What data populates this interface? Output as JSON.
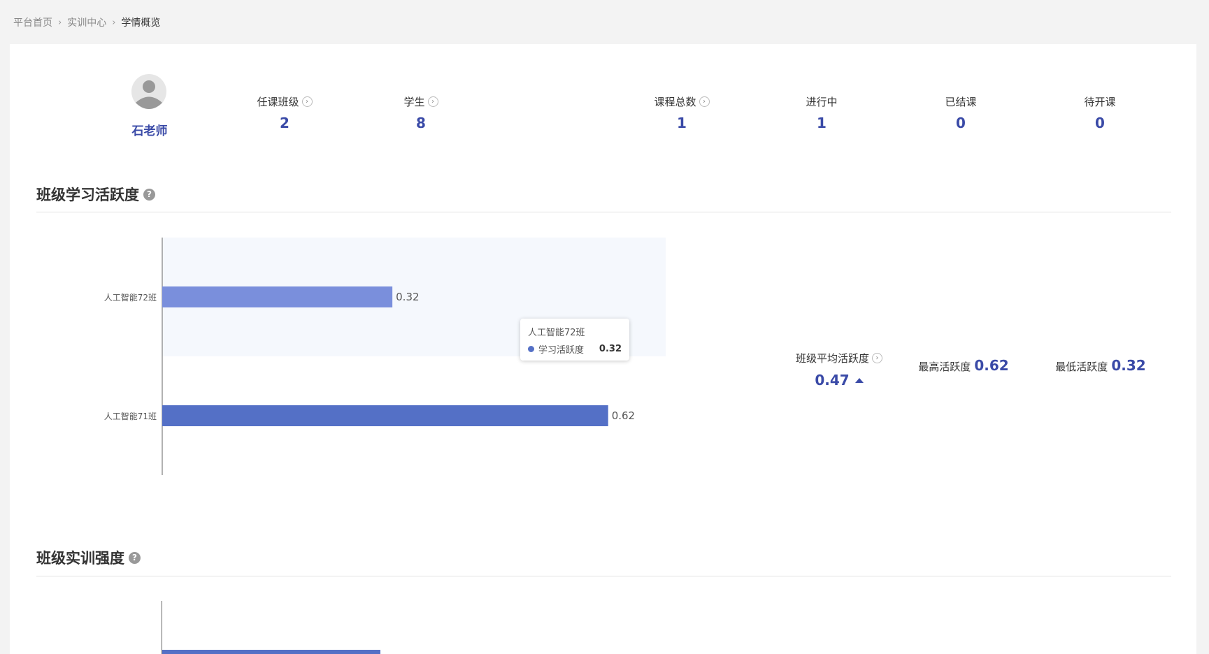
{
  "breadcrumb": {
    "items": [
      "平台首页",
      "实训中心"
    ],
    "current": "学情概览"
  },
  "teacher": {
    "name": "石老师"
  },
  "stats": [
    {
      "label": "任课班级",
      "value": "2",
      "has_arrow": true
    },
    {
      "label": "学生",
      "value": "8",
      "has_arrow": true
    },
    {
      "label": "课程总数",
      "value": "1",
      "has_arrow": true
    },
    {
      "label": "进行中",
      "value": "1",
      "has_arrow": false
    },
    {
      "label": "已结课",
      "value": "0",
      "has_arrow": false
    },
    {
      "label": "待开课",
      "value": "0",
      "has_arrow": false
    }
  ],
  "sections": {
    "activity_title": "班级学习活跃度",
    "training_title": "班级实训强度"
  },
  "chart_data": {
    "type": "bar",
    "orientation": "horizontal",
    "categories": [
      "人工智能72班",
      "人工智能71班"
    ],
    "series": [
      {
        "name": "学习活跃度",
        "values": [
          0.32,
          0.62
        ]
      }
    ],
    "highlighted_category": "人工智能72班",
    "colors": {
      "highlight": "#7a8fdc",
      "bar": "#5470c6"
    },
    "xlim": [
      0,
      0.7
    ]
  },
  "tooltip": {
    "title": "人工智能72班",
    "series_name": "学习活跃度",
    "value": "0.32"
  },
  "metrics": [
    {
      "label": "班级平均活跃度",
      "value": "0.47",
      "trend": "up"
    },
    {
      "label": "最高活跃度",
      "value": "0.62"
    },
    {
      "label": "最低活跃度",
      "value": "0.32"
    }
  ],
  "training_chart": {
    "colors": {
      "bar": "#5470c6"
    }
  }
}
